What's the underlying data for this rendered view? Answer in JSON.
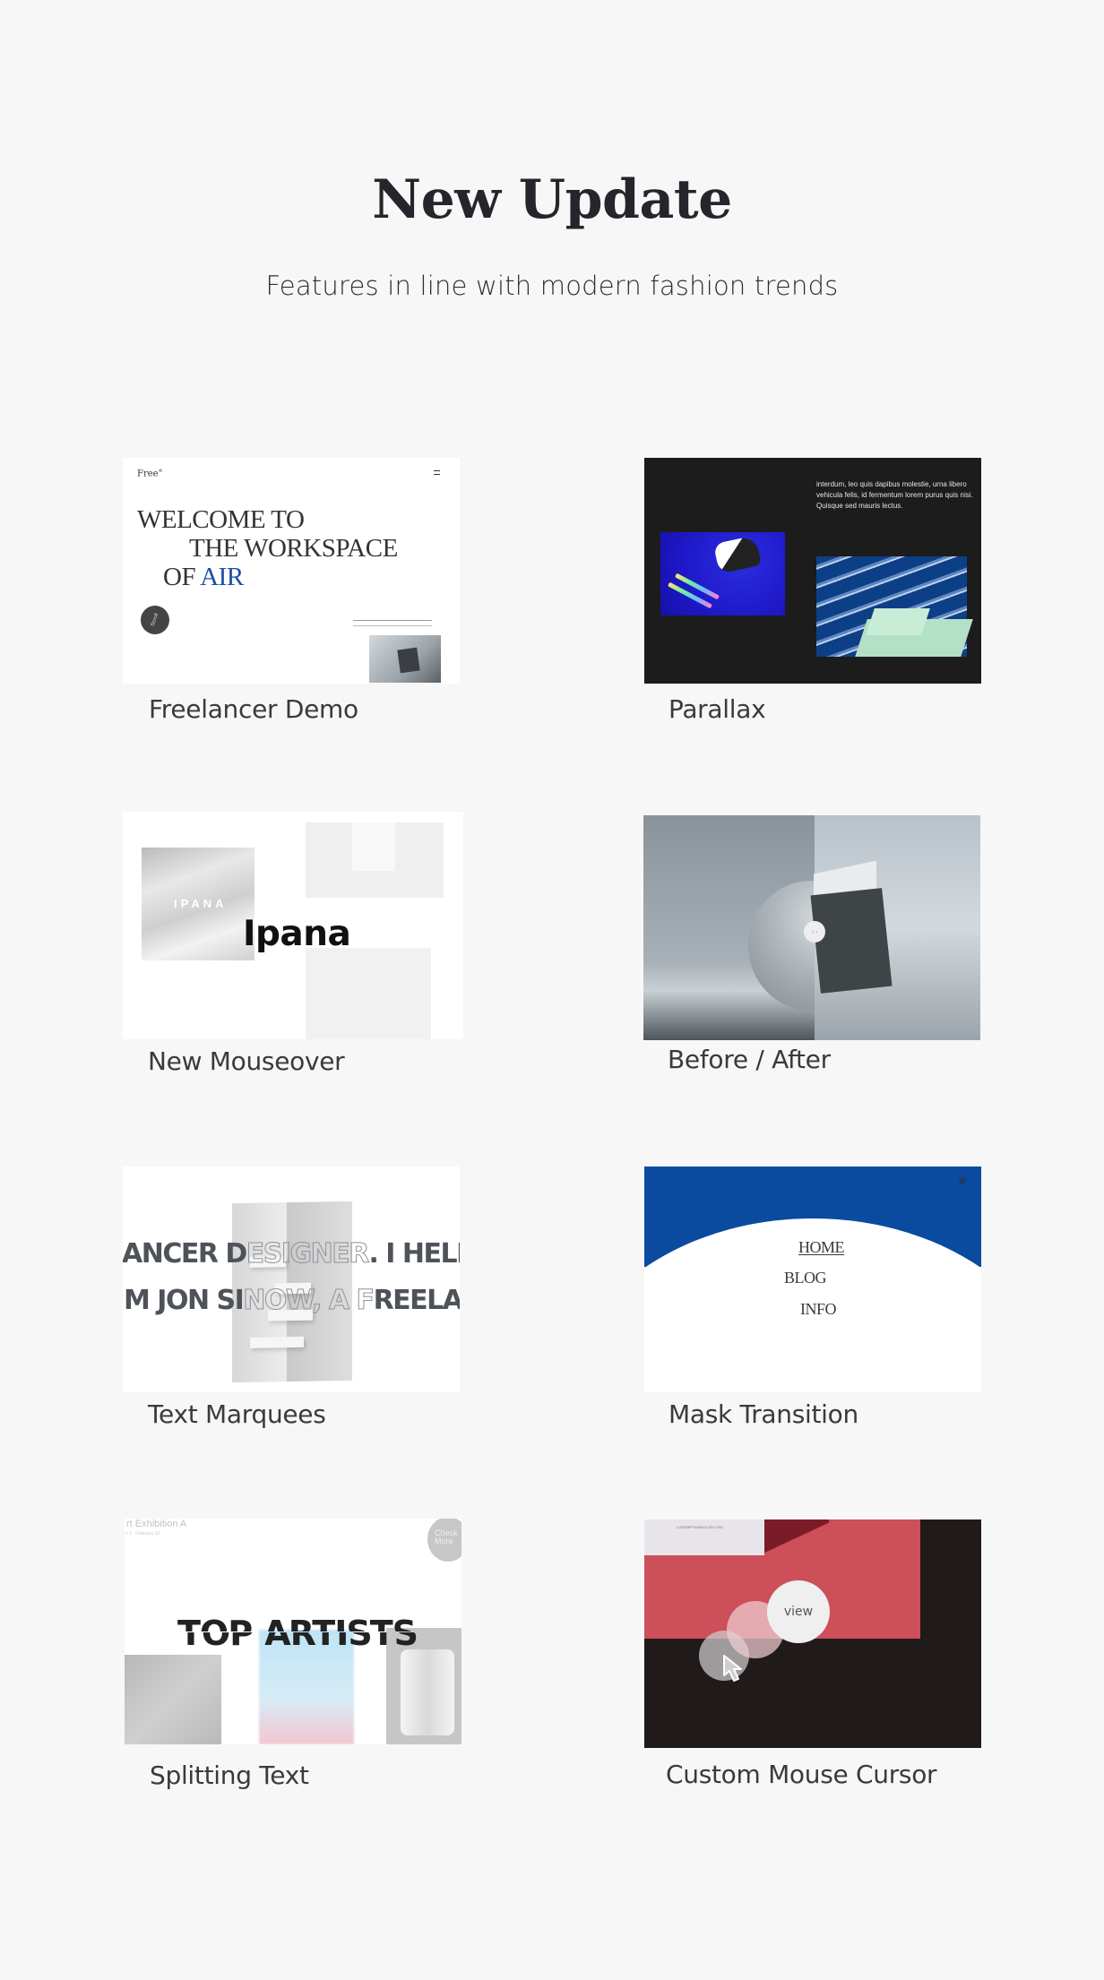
{
  "header": {
    "title": "New Update",
    "subtitle": "Features in line with modern fashion trends"
  },
  "colors": {
    "background": "#f7f7f7",
    "title": "#25252b",
    "accent_blue": "#0a4ba0",
    "cursor_red": "#cc4f59"
  },
  "cards": [
    {
      "label": "Freelancer Demo",
      "preview": {
        "logo": "Free",
        "logo_sup": "®",
        "menu_icon": "hamburger-icon",
        "headline": [
          "WELCOME TO",
          "THE WORKSPACE",
          "OF "
        ],
        "headline_accent": "AIR",
        "badge_text": "Scroll"
      }
    },
    {
      "label": "Parallax",
      "preview": {
        "body_text": "interdum, leo quis dapibus molestie, urna libero vehicula felis, id fermentum lorem purus quis nisi. Quisque sed mauris lectus."
      }
    },
    {
      "label": "New Mouseover",
      "preview": {
        "image_text": "IPANA",
        "hover_title": "Ipana"
      }
    },
    {
      "label": "Before / After",
      "preview": {
        "handle_icon": "‹ ›"
      }
    },
    {
      "label": "Text Marquees",
      "preview": {
        "line1_solid_a": "ANCER D",
        "line1_outline": "ESIGNER",
        "line1_solid_b": ". I HELP B",
        "line2_solid_a": "M JON SI",
        "line2_outline": "NOW, A F",
        "line2_solid_b": "REELANC"
      }
    },
    {
      "label": "Mask Transition",
      "preview": {
        "menu": [
          "HOME",
          "BLOG",
          "INFO"
        ]
      }
    },
    {
      "label": "Splitting Text",
      "preview": {
        "event_title": "rt Exhibition A",
        "event_dates": "r 2 - February 15",
        "circle_text": "Check More",
        "headline": "TOP ARTISTS"
      }
    },
    {
      "label": "Custom Mouse Cursor",
      "preview": {
        "paper_text": "LOREMIPSUMDOLOR.COM",
        "cursor_label": "view"
      }
    }
  ]
}
